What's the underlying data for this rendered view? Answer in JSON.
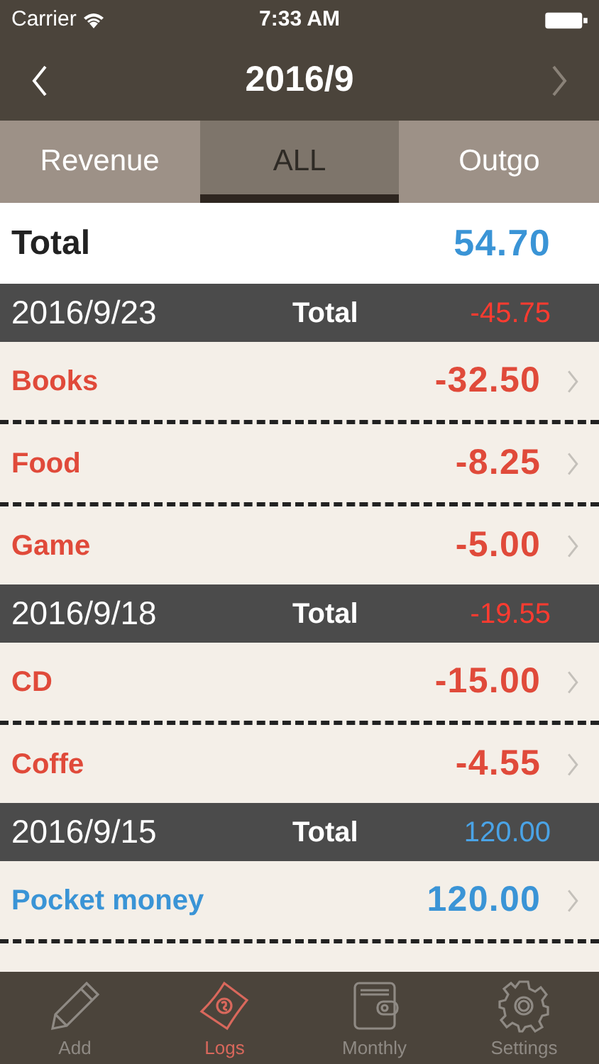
{
  "status_bar": {
    "carrier": "Carrier",
    "time": "7:33 AM"
  },
  "nav": {
    "title": "2016/9",
    "prev_enabled": true,
    "next_enabled": false
  },
  "tabs": [
    {
      "label": "Revenue",
      "selected": false
    },
    {
      "label": "ALL",
      "selected": true
    },
    {
      "label": "Outgo",
      "selected": false
    }
  ],
  "total": {
    "label": "Total",
    "amount": "54.70",
    "kind": "income"
  },
  "groups": [
    {
      "date": "2016/9/23",
      "total_label": "Total",
      "total": "-45.75",
      "kind": "expense",
      "entries": [
        {
          "name": "Books",
          "amount": "-32.50",
          "kind": "expense"
        },
        {
          "name": "Food",
          "amount": "-8.25",
          "kind": "expense"
        },
        {
          "name": "Game",
          "amount": "-5.00",
          "kind": "expense"
        }
      ]
    },
    {
      "date": "2016/9/18",
      "total_label": "Total",
      "total": "-19.55",
      "kind": "expense",
      "entries": [
        {
          "name": "CD",
          "amount": "-15.00",
          "kind": "expense"
        },
        {
          "name": "Coffe",
          "amount": "-4.55",
          "kind": "expense"
        }
      ]
    },
    {
      "date": "2016/9/15",
      "total_label": "Total",
      "total": "120.00",
      "kind": "income",
      "entries": [
        {
          "name": "Pocket money",
          "amount": "120.00",
          "kind": "income"
        }
      ]
    }
  ],
  "tab_bar": [
    {
      "label": "Add",
      "kind": "add",
      "selected": false
    },
    {
      "label": "Logs",
      "kind": "logs",
      "selected": true
    },
    {
      "label": "Monthly",
      "kind": "monthly",
      "selected": false
    },
    {
      "label": "Settings",
      "kind": "settings",
      "selected": false
    }
  ]
}
